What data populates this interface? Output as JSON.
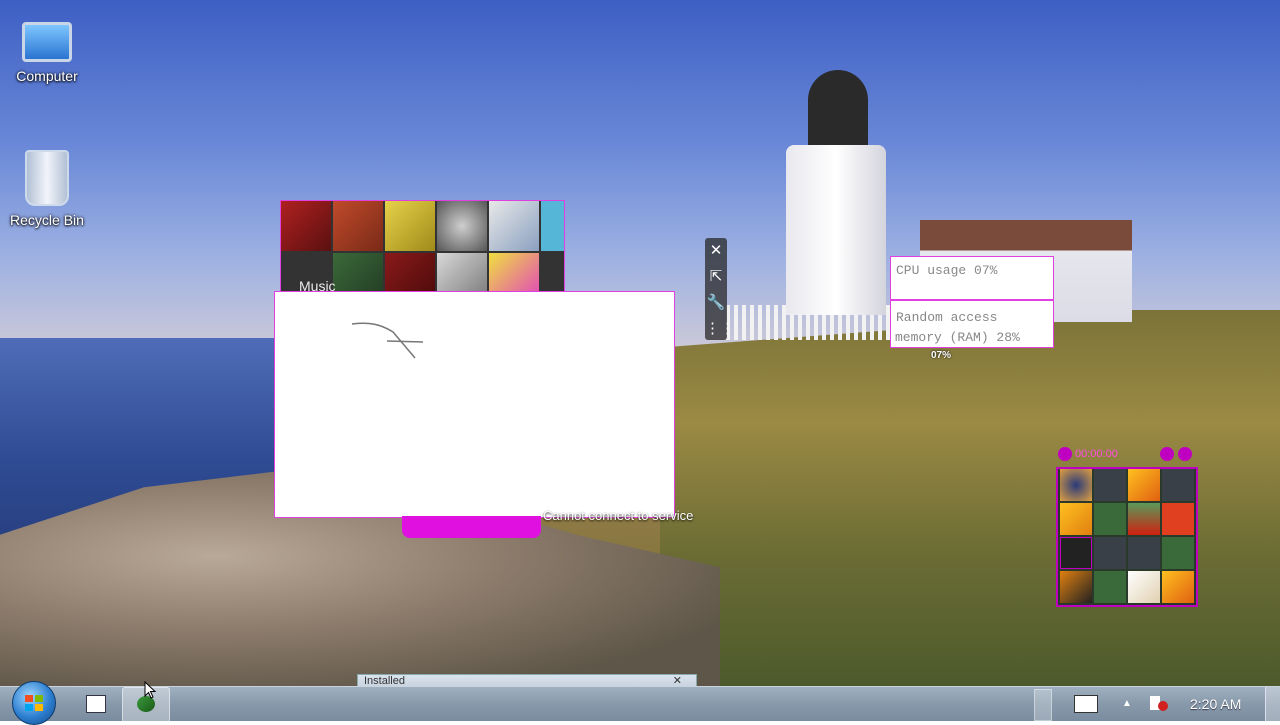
{
  "desktop": {
    "icons": [
      {
        "label": "Computer"
      },
      {
        "label": "Recycle Bin"
      }
    ]
  },
  "music_gadget": {
    "label": "Music"
  },
  "service_status": {
    "message": "Cannot connect to service"
  },
  "system_meter": {
    "cpu_text": "CPU usage 07%",
    "ram_line1": "Random access",
    "ram_line2": "memory (RAM) 28%",
    "small_pct": "07%"
  },
  "puzzle_gadget": {
    "timer": "00:00:00",
    "pieces": 16
  },
  "taskbar": {
    "floating_window_title": "Installed",
    "clock": "2:20 AM"
  },
  "colors": {
    "accent": "#e010e0",
    "taskbar": "#8899ab"
  }
}
